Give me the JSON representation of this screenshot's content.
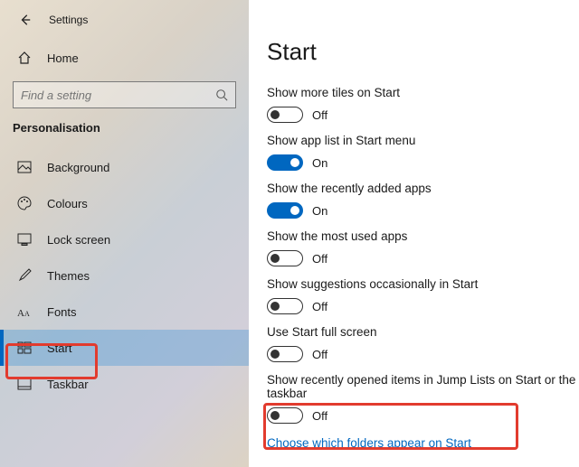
{
  "header": {
    "title": "Settings"
  },
  "home_label": "Home",
  "search": {
    "placeholder": "Find a setting"
  },
  "category": "Personalisation",
  "sidebar": {
    "items": [
      {
        "label": "Background"
      },
      {
        "label": "Colours"
      },
      {
        "label": "Lock screen"
      },
      {
        "label": "Themes"
      },
      {
        "label": "Fonts"
      },
      {
        "label": "Start"
      },
      {
        "label": "Taskbar"
      }
    ]
  },
  "page_title": "Start",
  "toggles": {
    "more_tiles": {
      "label": "Show more tiles on Start",
      "state": "Off",
      "on": false
    },
    "app_list": {
      "label": "Show app list in Start menu",
      "state": "On",
      "on": true
    },
    "recently_added": {
      "label": "Show the recently added apps",
      "state": "On",
      "on": true
    },
    "most_used": {
      "label": "Show the most used apps",
      "state": "Off",
      "on": false
    },
    "suggestions": {
      "label": "Show suggestions occasionally in Start",
      "state": "Off",
      "on": false
    },
    "full_screen": {
      "label": "Use Start full screen",
      "state": "Off",
      "on": false
    },
    "recent_items": {
      "label": "Show recently opened items in Jump Lists on Start or the taskbar",
      "state": "Off",
      "on": false
    }
  },
  "link_folders": "Choose which folders appear on Start"
}
